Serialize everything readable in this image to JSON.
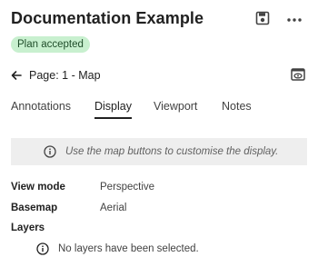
{
  "header": {
    "title": "Documentation Example",
    "save_icon": "save-icon",
    "more_icon": "more-horizontal-icon"
  },
  "status_badge": {
    "label": "Plan accepted",
    "color": "#c8f0cf"
  },
  "page": {
    "back_icon": "arrow-left-icon",
    "label": "Page: 1 - Map",
    "preview_icon": "preview-icon"
  },
  "tabs": [
    {
      "label": "Annotations",
      "active": false
    },
    {
      "label": "Display",
      "active": true
    },
    {
      "label": "Viewport",
      "active": false
    },
    {
      "label": "Notes",
      "active": false
    }
  ],
  "info_banner": {
    "icon": "info-icon",
    "message": "Use the map buttons to customise the display."
  },
  "properties": [
    {
      "key": "View mode",
      "value": "Perspective"
    },
    {
      "key": "Basemap",
      "value": "Aerial"
    }
  ],
  "layers": {
    "heading": "Layers",
    "icon": "info-icon",
    "empty_message": "No layers have been selected."
  }
}
